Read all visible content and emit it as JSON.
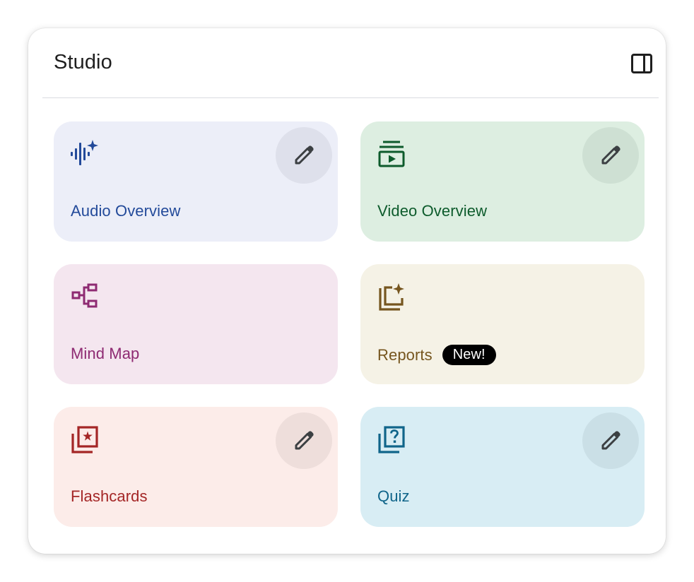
{
  "header": {
    "title": "Studio",
    "toggle_icon": "side-panel-icon"
  },
  "cards": [
    {
      "label": "Audio Overview",
      "icon": "audio-waveform-sparkle-icon",
      "bg": "#ECEEF8",
      "fg": "#234A9A",
      "has_edit": true,
      "edit_icon": "pencil-icon",
      "edit_bg": "#DEE0EB"
    },
    {
      "label": "Video Overview",
      "icon": "video-stack-play-icon",
      "bg": "#DDEEE1",
      "fg": "#0D5B2C",
      "has_edit": true,
      "edit_icon": "pencil-icon",
      "edit_bg": "#CEE0D3"
    },
    {
      "label": "Mind Map",
      "icon": "mind-map-icon",
      "bg": "#F4E6EF",
      "fg": "#8E2A72",
      "has_edit": false
    },
    {
      "label": "Reports",
      "badge": "New!",
      "icon": "report-sparkle-icon",
      "bg": "#F5F2E6",
      "fg": "#76561F",
      "has_edit": false
    },
    {
      "label": "Flashcards",
      "icon": "flashcards-icon",
      "bg": "#FCECE9",
      "fg": "#A42626",
      "has_edit": true,
      "edit_icon": "pencil-icon",
      "edit_bg": "#EEDEDB"
    },
    {
      "label": "Quiz",
      "icon": "quiz-icon",
      "bg": "#D8EDF4",
      "fg": "#10658A",
      "has_edit": true,
      "edit_icon": "pencil-icon",
      "edit_bg": "#CADFE6"
    }
  ]
}
